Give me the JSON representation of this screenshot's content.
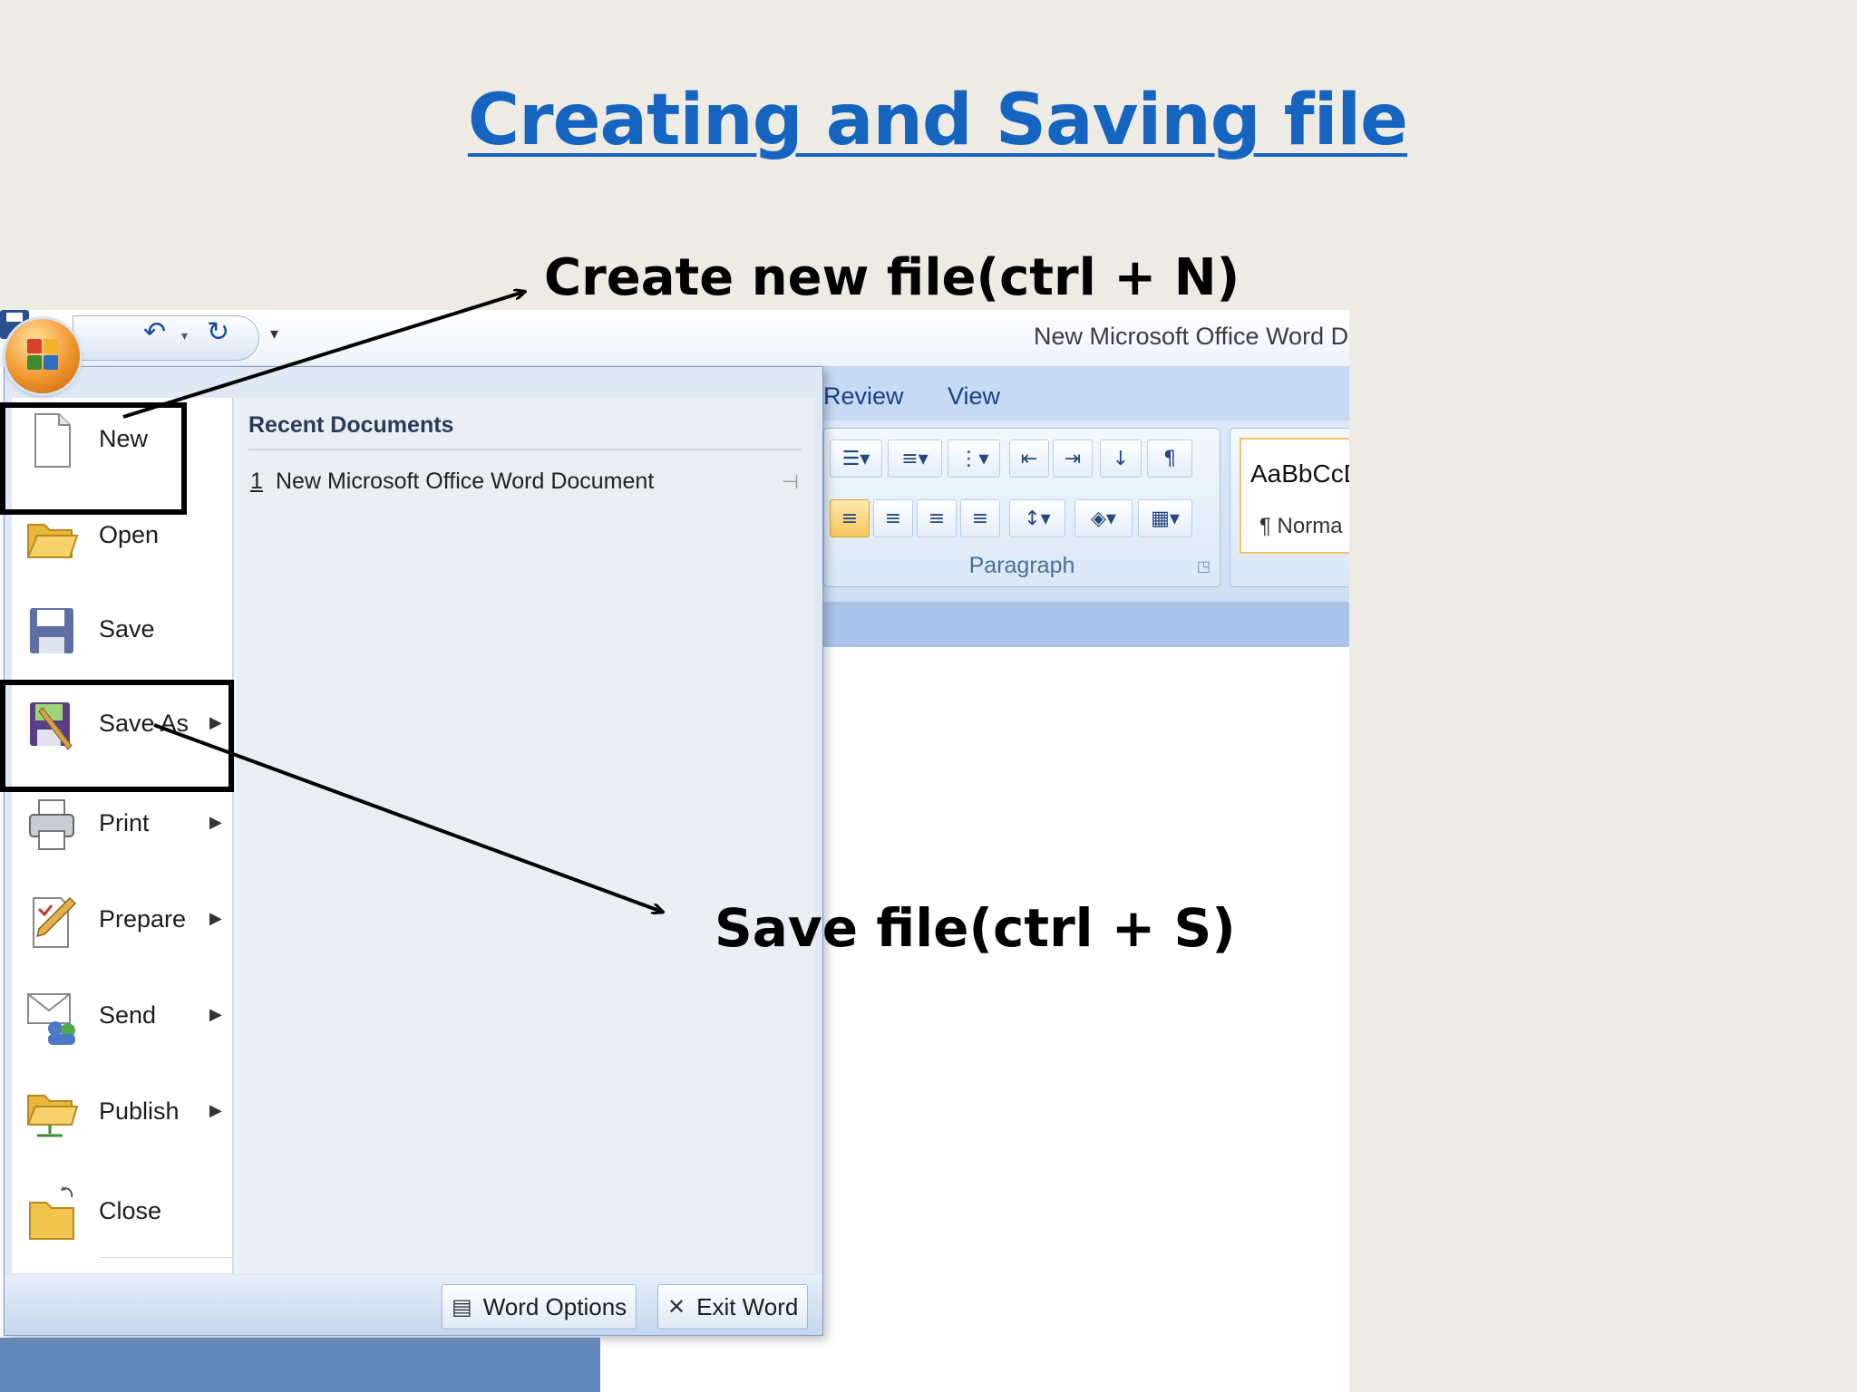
{
  "slide": {
    "title": "Creating and Saving file",
    "callout_new": "Create new file(ctrl + N)",
    "callout_save": "Save file(ctrl + S)"
  },
  "window": {
    "document_title": "New Microsoft Office Word Do",
    "ribbon_tabs": [
      "Review",
      "View"
    ],
    "paragraph_group_label": "Paragraph",
    "style_sample": "AaBbCcD",
    "style_name": "¶ Norma"
  },
  "office_menu": {
    "commands": [
      {
        "label": "New",
        "has_submenu": false,
        "icon": "new-document-icon"
      },
      {
        "label": "Open",
        "has_submenu": false,
        "icon": "open-folder-icon"
      },
      {
        "label": "Save",
        "has_submenu": false,
        "icon": "save-disk-icon"
      },
      {
        "label": "Save As",
        "has_submenu": true,
        "icon": "save-as-icon"
      },
      {
        "label": "Print",
        "has_submenu": true,
        "icon": "printer-icon"
      },
      {
        "label": "Prepare",
        "has_submenu": true,
        "icon": "prepare-icon"
      },
      {
        "label": "Send",
        "has_submenu": true,
        "icon": "send-icon"
      },
      {
        "label": "Publish",
        "has_submenu": true,
        "icon": "publish-icon"
      },
      {
        "label": "Close",
        "has_submenu": false,
        "icon": "close-folder-icon"
      }
    ],
    "recent_header": "Recent Documents",
    "recent_documents": [
      {
        "number": "1",
        "name": "New Microsoft Office Word Document"
      }
    ],
    "footer": {
      "word_options": "Word Options",
      "exit_word": "Exit Word"
    }
  },
  "colors": {
    "title_blue": "#1565c0",
    "ribbon_blue": "#c6daf3",
    "highlight": "#000000"
  }
}
